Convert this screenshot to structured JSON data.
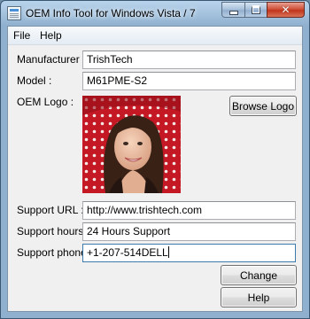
{
  "window": {
    "title": "OEM Info Tool for Windows Vista / 7",
    "close_glyph": "✕",
    "icons": [
      "app-icon",
      "minimize-icon",
      "maximize-icon",
      "close-icon"
    ]
  },
  "menu": {
    "file": "File",
    "help": "Help"
  },
  "form": {
    "manufacturer_label": "Manufacturer :",
    "manufacturer_value": "TrishTech",
    "model_label": "Model :",
    "model_value": "M61PME-S2",
    "logo_label": "OEM Logo :",
    "browse_logo": "Browse Logo",
    "support_url_label": "Support URL :",
    "support_url_value": "http://www.trishtech.com",
    "support_hours_label": "Support hours :",
    "support_hours_value": "24 Hours Support",
    "support_phone_label": "Support phone :",
    "support_phone_value": "+1-207-514DELL"
  },
  "buttons": {
    "change": "Change",
    "help": "Help"
  },
  "colors": {
    "title_gradient_top": "#b8d3ec",
    "frame": "#8fb0cf",
    "client_bg": "#f0f0f0",
    "close_button": "#c1361b",
    "focus_border": "#3d7bad"
  }
}
